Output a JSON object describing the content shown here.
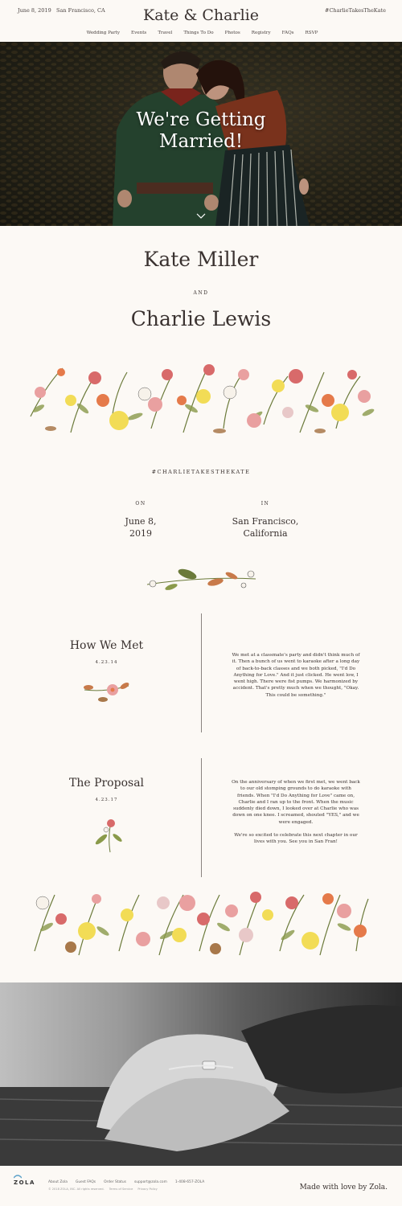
{
  "header": {
    "date": "June 8, 2019",
    "location": "San Francisco, CA",
    "title": "Kate & Charlie",
    "hashtag": "#CharlieTakesTheKate",
    "nav": [
      "Wedding Party",
      "Events",
      "Travel",
      "Things To Do",
      "Photos",
      "Registry",
      "FAQs",
      "RSVP"
    ]
  },
  "hero": {
    "line1": "We're Getting",
    "line2": "Married!"
  },
  "couple": {
    "name1": "Kate Miller",
    "and": "AND",
    "name2": "Charlie Lewis"
  },
  "details": {
    "hashtag": "#CHARLIETAKESTHEKATE",
    "on_label": "ON",
    "date_line1": "June 8,",
    "date_line2": "2019",
    "in_label": "IN",
    "place_line1": "San Francisco,",
    "place_line2": "California"
  },
  "stories": [
    {
      "title": "How We Met",
      "date": "4.23.14",
      "paragraphs": [
        "We met at a classmate's party and didn't think much of it. Then a bunch of us went to karaoke after a long day of back-to-back classes and we both picked, \"I'd Do Anything for Love.\" And it just clicked. He went low, I went high. There were fist pumps. We harmonized by accident. That's pretty much when we thought, \"Okay. This could be something.\""
      ]
    },
    {
      "title": "The Proposal",
      "date": "4.23.17",
      "paragraphs": [
        "On the anniversary of when we first met, we went back to our old stomping grounds to do karaoke with friends. When \"I'd Do Anything for Love\" came on, Charlie and I ran up to the front. When the music suddenly died down, I looked over at Charlie who was down on one knee. I screamed, shouted \"YES,\" and we were engaged.",
        "We're so excited to celebrate this next chapter in our lives with you. See you in San Fran!"
      ]
    }
  ],
  "footer": {
    "logo": "ZOLA",
    "links": [
      "About Zola",
      "Guest FAQs",
      "Order Status",
      "support@zola.com",
      "1-408-657-ZOLA"
    ],
    "copyright": [
      "© 2018 ZOLA, INC. All rights reserved.",
      "Terms of Service",
      "Privacy Policy"
    ],
    "made_with": "Made with love by Zola."
  },
  "colors": {
    "background": "#fcf9f5",
    "text": "#3a3230",
    "divider": "#8a8480"
  }
}
